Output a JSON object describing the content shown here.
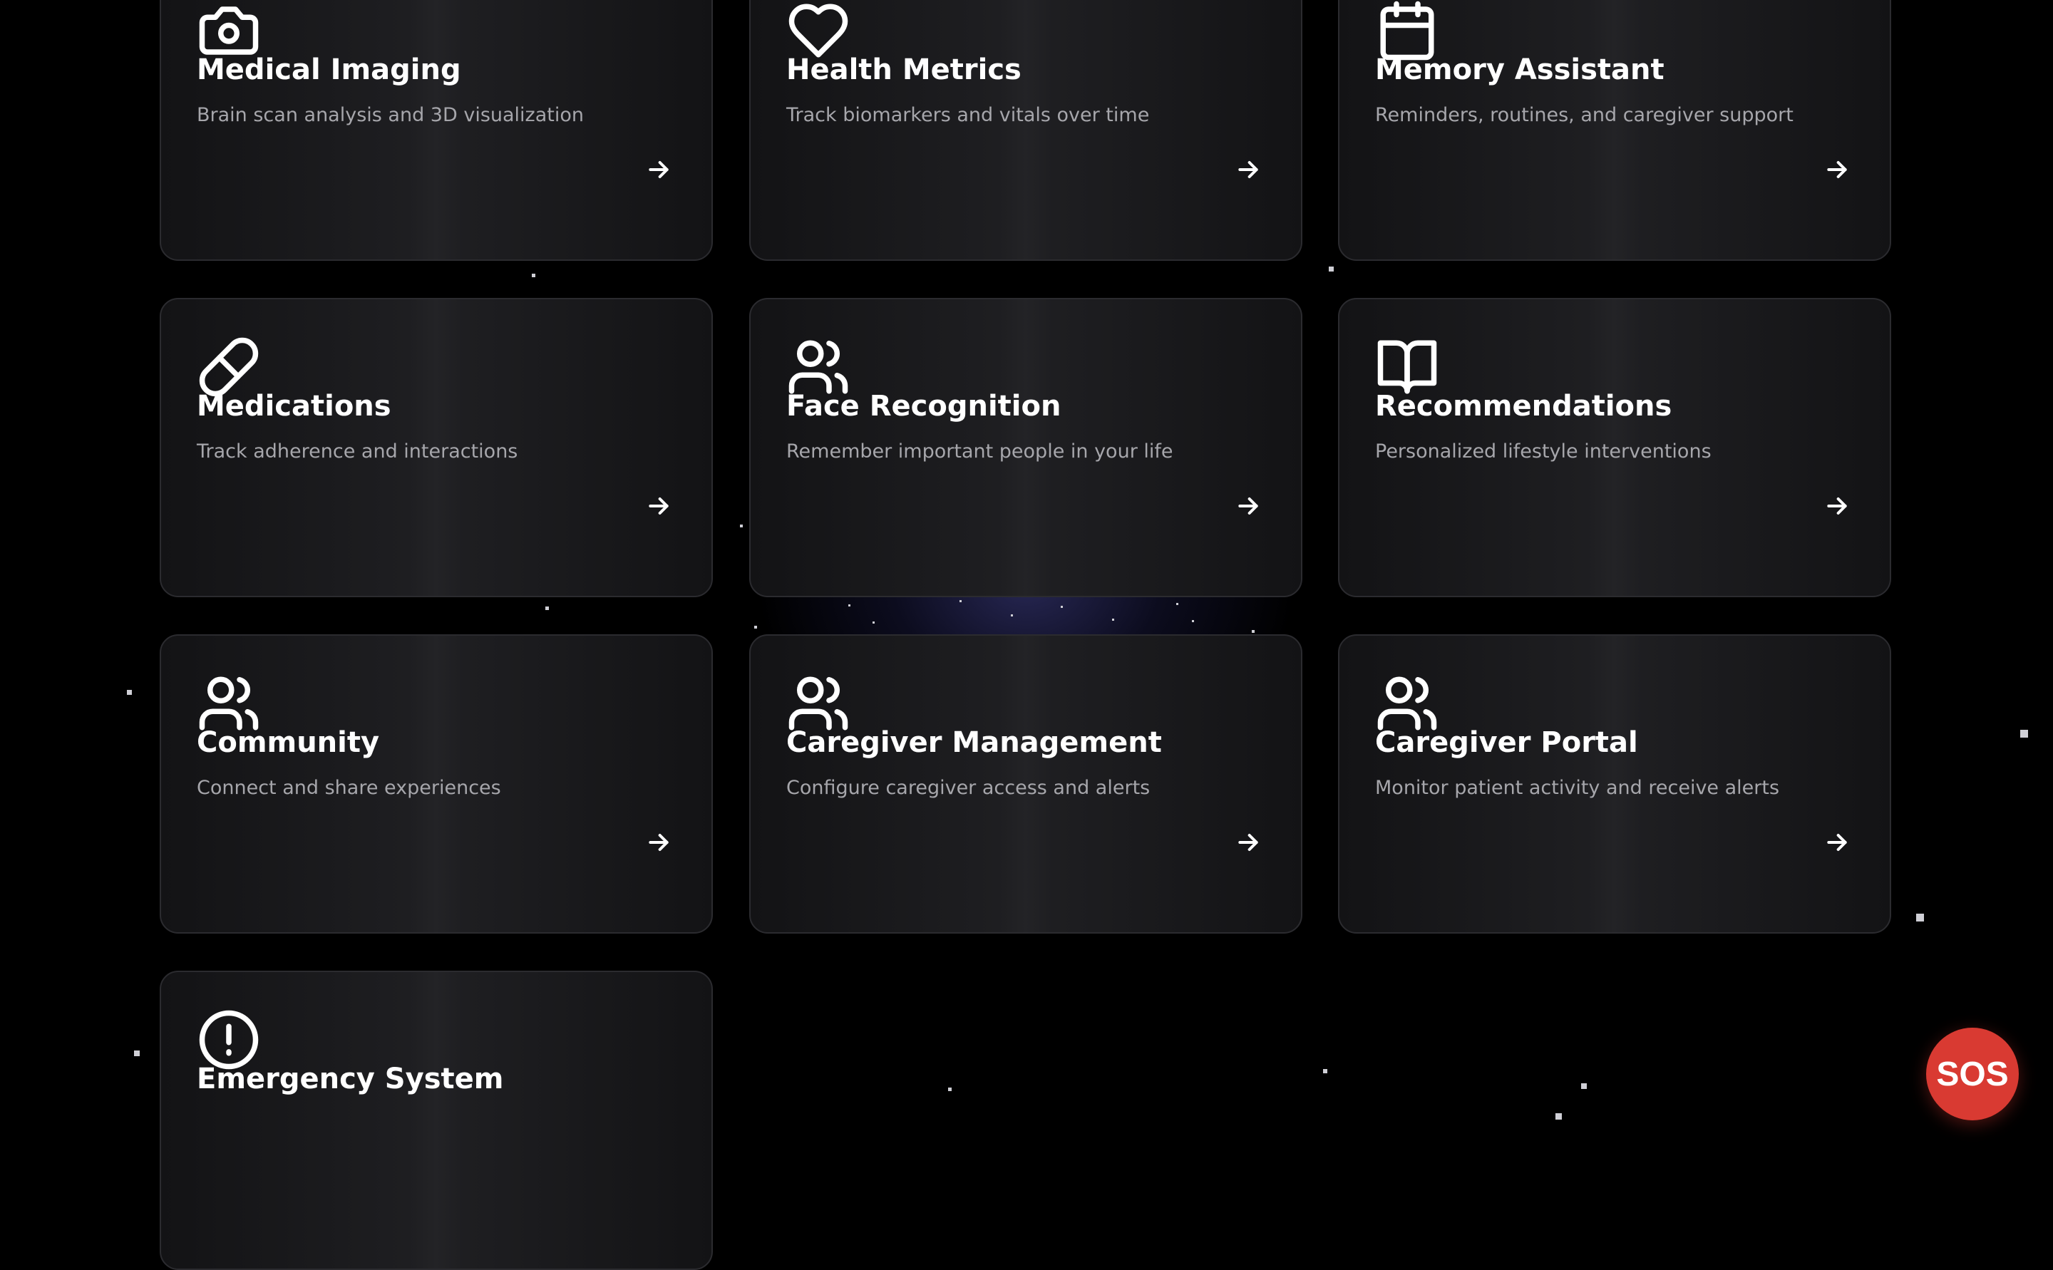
{
  "theme": {
    "background": "#000000",
    "accent_sos": "#d93a32",
    "card_border": "#2b2b2f",
    "text_secondary": "#a6a6ab"
  },
  "cards": [
    {
      "title": "Medical Imaging",
      "description": "Brain scan analysis and 3D visualization",
      "icon": "camera-icon"
    },
    {
      "title": "Health Metrics",
      "description": "Track biomarkers and vitals over time",
      "icon": "heart-icon"
    },
    {
      "title": "Memory Assistant",
      "description": "Reminders, routines, and caregiver support",
      "icon": "calendar-icon"
    },
    {
      "title": "Medications",
      "description": "Track adherence and interactions",
      "icon": "pill-icon"
    },
    {
      "title": "Face Recognition",
      "description": "Remember important people in your life",
      "icon": "users-icon"
    },
    {
      "title": "Recommendations",
      "description": "Personalized lifestyle interventions",
      "icon": "book-open-icon"
    },
    {
      "title": "Community",
      "description": "Connect and share experiences",
      "icon": "users-icon"
    },
    {
      "title": "Caregiver Management",
      "description": "Configure caregiver access and alerts",
      "icon": "users-icon"
    },
    {
      "title": "Caregiver Portal",
      "description": "Monitor patient activity and receive alerts",
      "icon": "users-icon"
    },
    {
      "title": "Emergency System",
      "description": "",
      "icon": "alert-circle-icon"
    }
  ],
  "sos": {
    "label": "SOS"
  }
}
